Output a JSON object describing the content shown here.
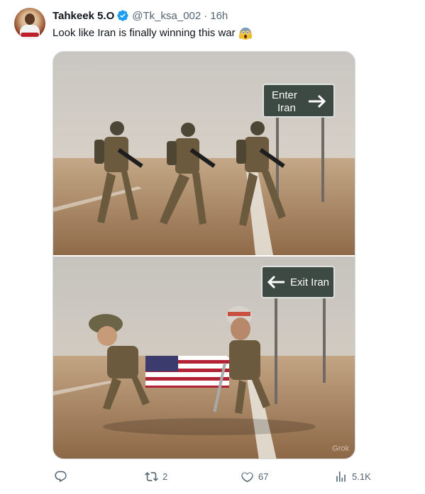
{
  "tweet": {
    "display_name": "Tahkeek 5.O",
    "handle": "@Tk_ksa_002",
    "separator": "·",
    "time": "16h",
    "text": "Look like Iran is finally winning this war",
    "emoji": "scream-face-emoji",
    "verified_color": "#1d9bf0"
  },
  "media": {
    "top_sign": {
      "line1": "Enter",
      "line2": "Iran",
      "arrow": "right-arrow-icon"
    },
    "bottom_sign": {
      "text": "Exit Iran",
      "arrow": "left-arrow-icon"
    },
    "watermark": "Grok",
    "sign_color": "#3d4a44"
  },
  "actions": {
    "reply": {
      "icon": "reply-icon",
      "count": ""
    },
    "retweet": {
      "icon": "retweet-icon",
      "count": "2"
    },
    "like": {
      "icon": "heart-icon",
      "count": "67"
    },
    "views": {
      "icon": "views-icon",
      "count": "5.1K"
    }
  }
}
